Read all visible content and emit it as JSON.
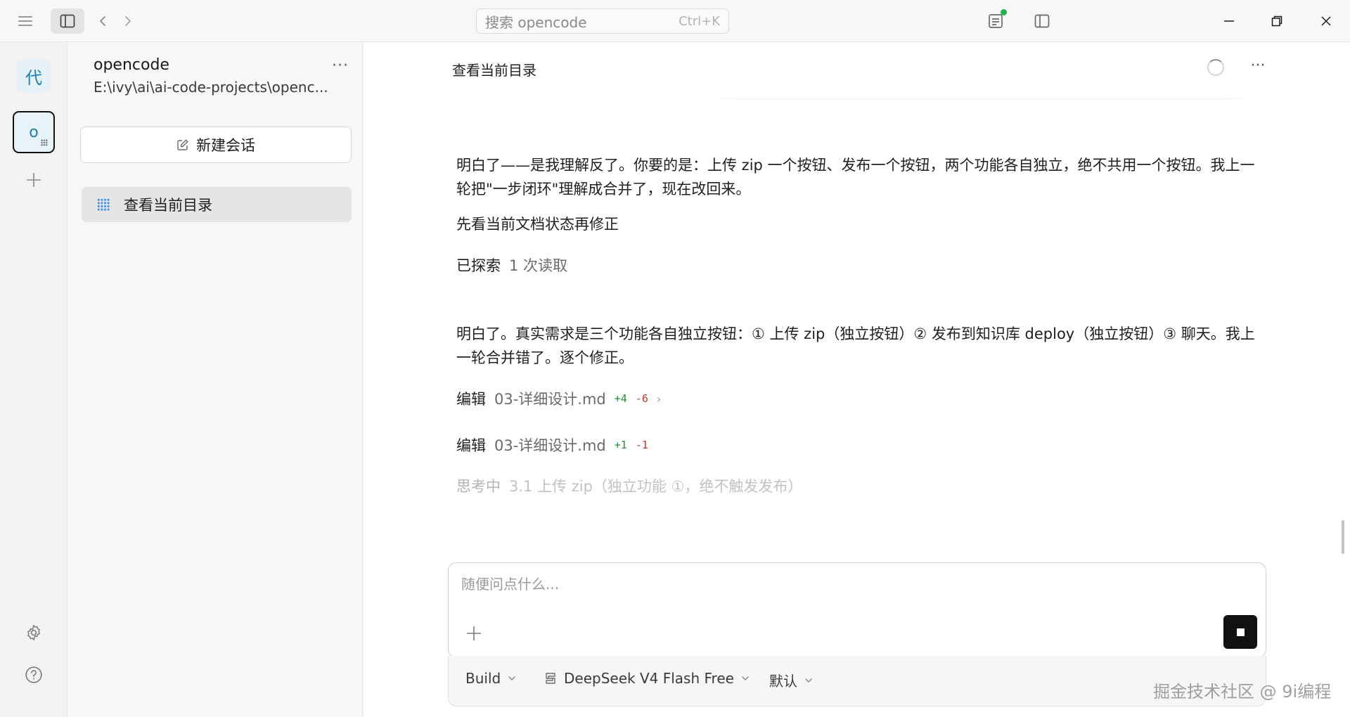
{
  "titlebar": {
    "search_placeholder": "搜索 opencode",
    "search_shortcut": "Ctrl+K"
  },
  "rail": {
    "projects": [
      {
        "label": "代"
      },
      {
        "label": "o"
      }
    ]
  },
  "sidebar": {
    "project_name": "opencode",
    "project_path": "E:\\ivy\\ai\\ai-code-projects\\openc...",
    "more": "···",
    "new_session_label": "新建会话",
    "sessions": [
      {
        "title": "查看当前目录"
      }
    ]
  },
  "main": {
    "title": "查看当前目录",
    "more": "···",
    "messages": [
      {
        "text": "明白了——是我理解反了。你要的是：上传 zip 一个按钮、发布一个按钮，两个功能各自独立，绝不共用一个按钮。我上一轮把\"一步闭环\"理解成合并了，现在改回来。"
      },
      {
        "text": "先看当前文档状态再修正"
      }
    ],
    "explored": {
      "label": "已探索",
      "detail": "1 次读取"
    },
    "message2": "明白了。真实需求是三个功能各自独立按钮：① 上传 zip（独立按钮）② 发布到知识库 deploy（独立按钮）③ 聊天。我上一轮合并错了。逐个修正。",
    "edits": [
      {
        "label": "编辑",
        "file": "03-详细设计.md",
        "add": "+4",
        "del": "-6",
        "chevron": "›"
      },
      {
        "label": "编辑",
        "file": "03-详细设计.md",
        "add": "+1",
        "del": "-1",
        "chevron": ""
      }
    ],
    "thinking": {
      "label": "思考中",
      "detail": "3.1 上传 zip（独立功能 ①，绝不触发发布）"
    }
  },
  "composer": {
    "placeholder": "随便问点什么..."
  },
  "tray": {
    "agent": "Build",
    "model": "DeepSeek V4 Flash Free",
    "variant": "默认"
  },
  "watermark": "掘金技术社区 @ 9i编程"
}
